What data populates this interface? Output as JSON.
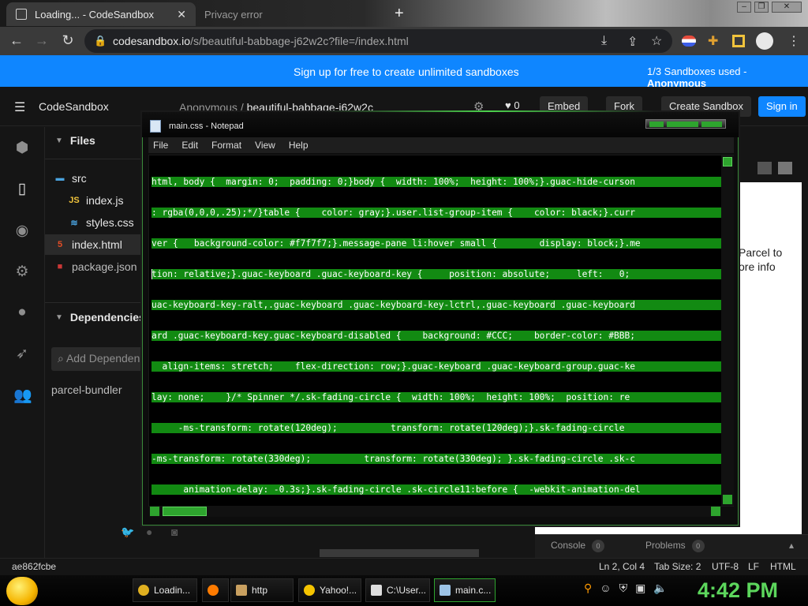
{
  "browser": {
    "tabs": [
      {
        "title": "Loading... - CodeSandbox",
        "active": true
      },
      {
        "title": "Privacy error",
        "active": false
      }
    ],
    "new_tab": "+",
    "url_host": "codesandbox.io",
    "url_path": "/s/beautiful-babbage-j62w2c?file=/index.html"
  },
  "banner": {
    "text": "Sign up for free to create unlimited sandboxes",
    "usage": "1/3 Sandboxes used - ",
    "user": "Anonymous"
  },
  "header": {
    "title": "CodeSandbox",
    "owner": "Anonymous",
    "sep": "/",
    "sandbox": "beautiful-babbage-j62w2c",
    "likes": "0",
    "embed": "Embed",
    "fork": "Fork",
    "create": "Create Sandbox",
    "signin": "Sign in"
  },
  "sidebar": {
    "files_heading": "Files",
    "tree": [
      {
        "name": "src",
        "icon": "folder-icon",
        "color": "#4aa3df"
      },
      {
        "name": "index.js",
        "icon": "js-file-icon",
        "color": "#f0c33c"
      },
      {
        "name": "styles.css",
        "icon": "css-file-icon",
        "color": "#4aa3df"
      },
      {
        "name": "index.html",
        "icon": "html-file-icon",
        "color": "#e44d26"
      },
      {
        "name": "package.json",
        "icon": "npm-file-icon",
        "color": "#cb3837"
      }
    ],
    "deps_heading": "Dependencies",
    "deps_placeholder": "Add Dependency",
    "deps": [
      "parcel-bundler"
    ]
  },
  "preview": {
    "line1": "Parcel to",
    "line2": "ore info"
  },
  "console": {
    "console_label": "Console",
    "console_count": "0",
    "problems_label": "Problems",
    "problems_count": "0"
  },
  "statusbar": {
    "commit": "ae862fcbe",
    "cursor": "Ln 2, Col 4",
    "tab_size": "Tab Size: 2",
    "encoding": "UTF-8",
    "eol": "LF",
    "language": "HTML"
  },
  "notepad": {
    "title": "main.css - Notepad",
    "menu": [
      "File",
      "Edit",
      "Format",
      "View",
      "Help"
    ],
    "lines": [
      "html, body {  margin: 0;  padding: 0;}body {  width: 100%;  height: 100%;}.guac-hide-curson",
      ": rgba(0,0,0,.25);*/}table {    color: gray;}.user.list-group-item {    color: black;}.curr",
      "ver {   background-color: #f7f7f7;}.message-pane li:hover small {        display: block;}.me",
      "tion: relative;}.guac-keyboard .guac-keyboard-key {     position: absolute;     left:   0;",
      "uac-keyboard-key-ralt,.guac-keyboard .guac-keyboard-key-lctrl,.guac-keyboard .guac-keyboard",
      "ard .guac-keyboard-key.guac-keyboard-disabled {    background: #CCC;    border-color: #BBB;",
      "  align-items: stretch;    flex-direction: row;}.guac-keyboard .guac-keyboard-group.guac-ke",
      "lay: none;    }/* Spinner */.sk-fading-circle {  width: 100%;  height: 100%;  position: re",
      "     -ms-transform: rotate(120deg);          transform: rotate(120deg);}.sk-fading-circle",
      "-ms-transform: rotate(330deg);          transform: rotate(330deg); }.sk-fading-circle .sk-c",
      "      animation-delay: -0.3s;}.sk-fading-circle .sk-circle11:before {  -webkit-animation-del"
    ]
  },
  "taskbar": {
    "items": [
      {
        "label": "Loadin...",
        "icon": "chrome-icon",
        "color": "#e0b020"
      },
      {
        "label": "",
        "icon": "firefox-icon",
        "color": "#ff7b00"
      },
      {
        "label": "http",
        "icon": "book-icon",
        "color": "#c8a060"
      },
      {
        "label": "Yahoo!...",
        "icon": "smiley-icon",
        "color": "#f5c400"
      },
      {
        "label": "C:\\User...",
        "icon": "cmd-icon",
        "color": "#dddddd"
      },
      {
        "label": "main.c...",
        "icon": "notepad-icon",
        "color": "#9cc3e6"
      }
    ],
    "clock": "4:42 PM"
  }
}
